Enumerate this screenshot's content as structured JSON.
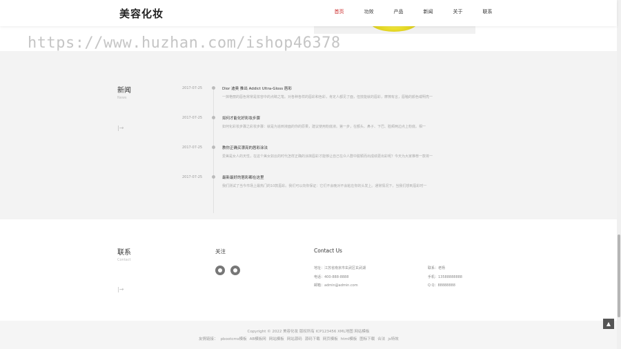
{
  "header": {
    "logo": "美容化妆",
    "nav": [
      "首页",
      "功效",
      "产品",
      "新闻",
      "关于",
      "联系"
    ],
    "active_index": 0
  },
  "watermark": "https://www.huzhan.com/ishop46378",
  "news": {
    "title": "新闻",
    "subtitle": "News",
    "more": "|→",
    "items": [
      {
        "date": "2017-07-25",
        "title": "Dior 迪奥 推出 Addict Ultra-Gloss 唇彩",
        "desc": "一抹艳丽的唇色常常是妆容中的点睛之笔。对各种各样的唇彩和色彩，肯定人都见了面，但技能就的唇彩，摩擦有言，唇釉的颜色或明亮一"
      },
      {
        "date": "2017-07-25",
        "title": "如何才能化好彩妆步骤",
        "desc": "如何化彩妆步骤之彩妆步骤：就是为追到液面的你的原果，建议使用粉底液。第一步，在额头、鼻子、下巴、脸颊两边点上粉底。相一"
      },
      {
        "date": "2017-07-25",
        "title": "教你正确买漂亮的唇彩涂法",
        "desc": "爱美是女人的天性，在这个美女如云的时代怎样正确的涂抹唇彩才能够让自己在众人群中脱颖而出成绩更出彩呢？今天为大家推荐一款将一"
      },
      {
        "date": "2017-07-25",
        "title": "最新最好的唇彩都在这里",
        "desc": "我们测试了当今市场上最热门的10款唇彩。我们可以向你保证：它们不会晚对不会粘在你的头发上。通常情况下，当我们想到唇彩时一"
      }
    ]
  },
  "contact": {
    "title": "联系",
    "subtitle": "Contact",
    "more": "|→",
    "follow_title": "关注",
    "social_icons": [
      "weibo-icon",
      "wechat-icon"
    ],
    "us_title": "Contact Us",
    "address": "地址：江苏省南京市玄武区玄武湖",
    "phone": "电话：400-888-8888",
    "email": "邮箱：admin@admin.com",
    "contact_person": "联系：老杨",
    "mobile": "手机：13588888888",
    "qq": "Q Q：88888888"
  },
  "footer": {
    "copyright": "Copyright © 2022 美容化妆 版权所有 ICP123456 XML地图 网站模板",
    "friend_label": "友情链接：",
    "friend_links": [
      "pbootcms模板",
      "AB模板网",
      "网站模板",
      "网站源码",
      "源码下载",
      "网页模板",
      "html模板",
      "图标下载",
      "合法",
      "js特效"
    ]
  },
  "back_to_top": "▲"
}
